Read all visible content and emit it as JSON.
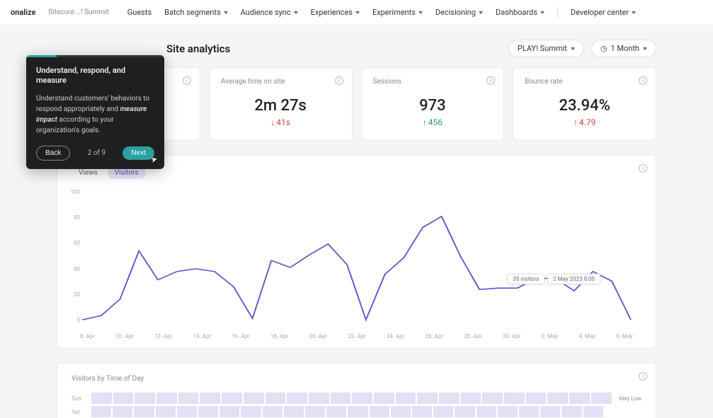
{
  "topbar": {
    "brand": "onalize",
    "crumb": "Sitecore …! Summit",
    "nav": [
      "Guests",
      "Batch segments",
      "Audience sync",
      "Experiences",
      "Experiments",
      "Decisioning",
      "Dashboards"
    ],
    "dev": "Developer center"
  },
  "page": {
    "title": "Site analytics",
    "site_selector": "PLAY! Summit",
    "period_selector": "1 Month"
  },
  "cards": [
    {
      "title": "",
      "value": "",
      "delta": "",
      "dir": ""
    },
    {
      "title": "Average time on site",
      "value": "2m 27s",
      "delta": "41s",
      "dir": "down"
    },
    {
      "title": "Sessions",
      "value": "973",
      "delta": "456",
      "dir": "up"
    },
    {
      "title": "Bounce rate",
      "value": "23.94%",
      "delta": "4.79",
      "dir": "up-red"
    }
  ],
  "tour": {
    "heading": "Understand, respond, and measure",
    "text_before": "Understand customers' behaviors to respond appropriately and ",
    "text_em": "measure impact",
    "text_after": " according to your organization's goals.",
    "back": "Back",
    "step": "2 of 9",
    "next": "Next"
  },
  "chart": {
    "tabs": [
      "Views",
      "Visitors"
    ],
    "active_tab": 1,
    "tooltip_value": "35 visitors",
    "tooltip_time": "2 May 2023 0:00"
  },
  "chart_data": {
    "type": "line",
    "title": "",
    "xlabel": "",
    "ylabel": "",
    "ylim": [
      0,
      100
    ],
    "y_ticks": [
      100,
      80,
      60,
      40,
      20,
      0
    ],
    "x_ticks": [
      "8. Apr",
      "10. Apr",
      "12. Apr",
      "14. Apr",
      "16. Apr",
      "18. Apr",
      "20. Apr",
      "22. Apr",
      "24. Apr",
      "26. Apr",
      "28. Apr",
      "30. Apr",
      "2. May",
      "4. May",
      "6. May"
    ],
    "series": [
      {
        "name": "Visitors",
        "values": [
          5,
          8,
          20,
          55,
          34,
          40,
          42,
          40,
          29,
          6,
          48,
          43,
          52,
          60,
          45,
          5,
          38,
          50,
          72,
          80,
          51,
          27,
          28,
          28,
          35,
          35,
          26,
          40,
          33,
          5
        ]
      }
    ],
    "tooltip_point": {
      "index": 24,
      "value": 35,
      "label": "2 May 2023 0:00"
    }
  },
  "heatmap": {
    "title": "Visitors by Time of Day",
    "days": [
      "Sun",
      "Sat"
    ],
    "legend": "Very Low",
    "cols": 24
  }
}
